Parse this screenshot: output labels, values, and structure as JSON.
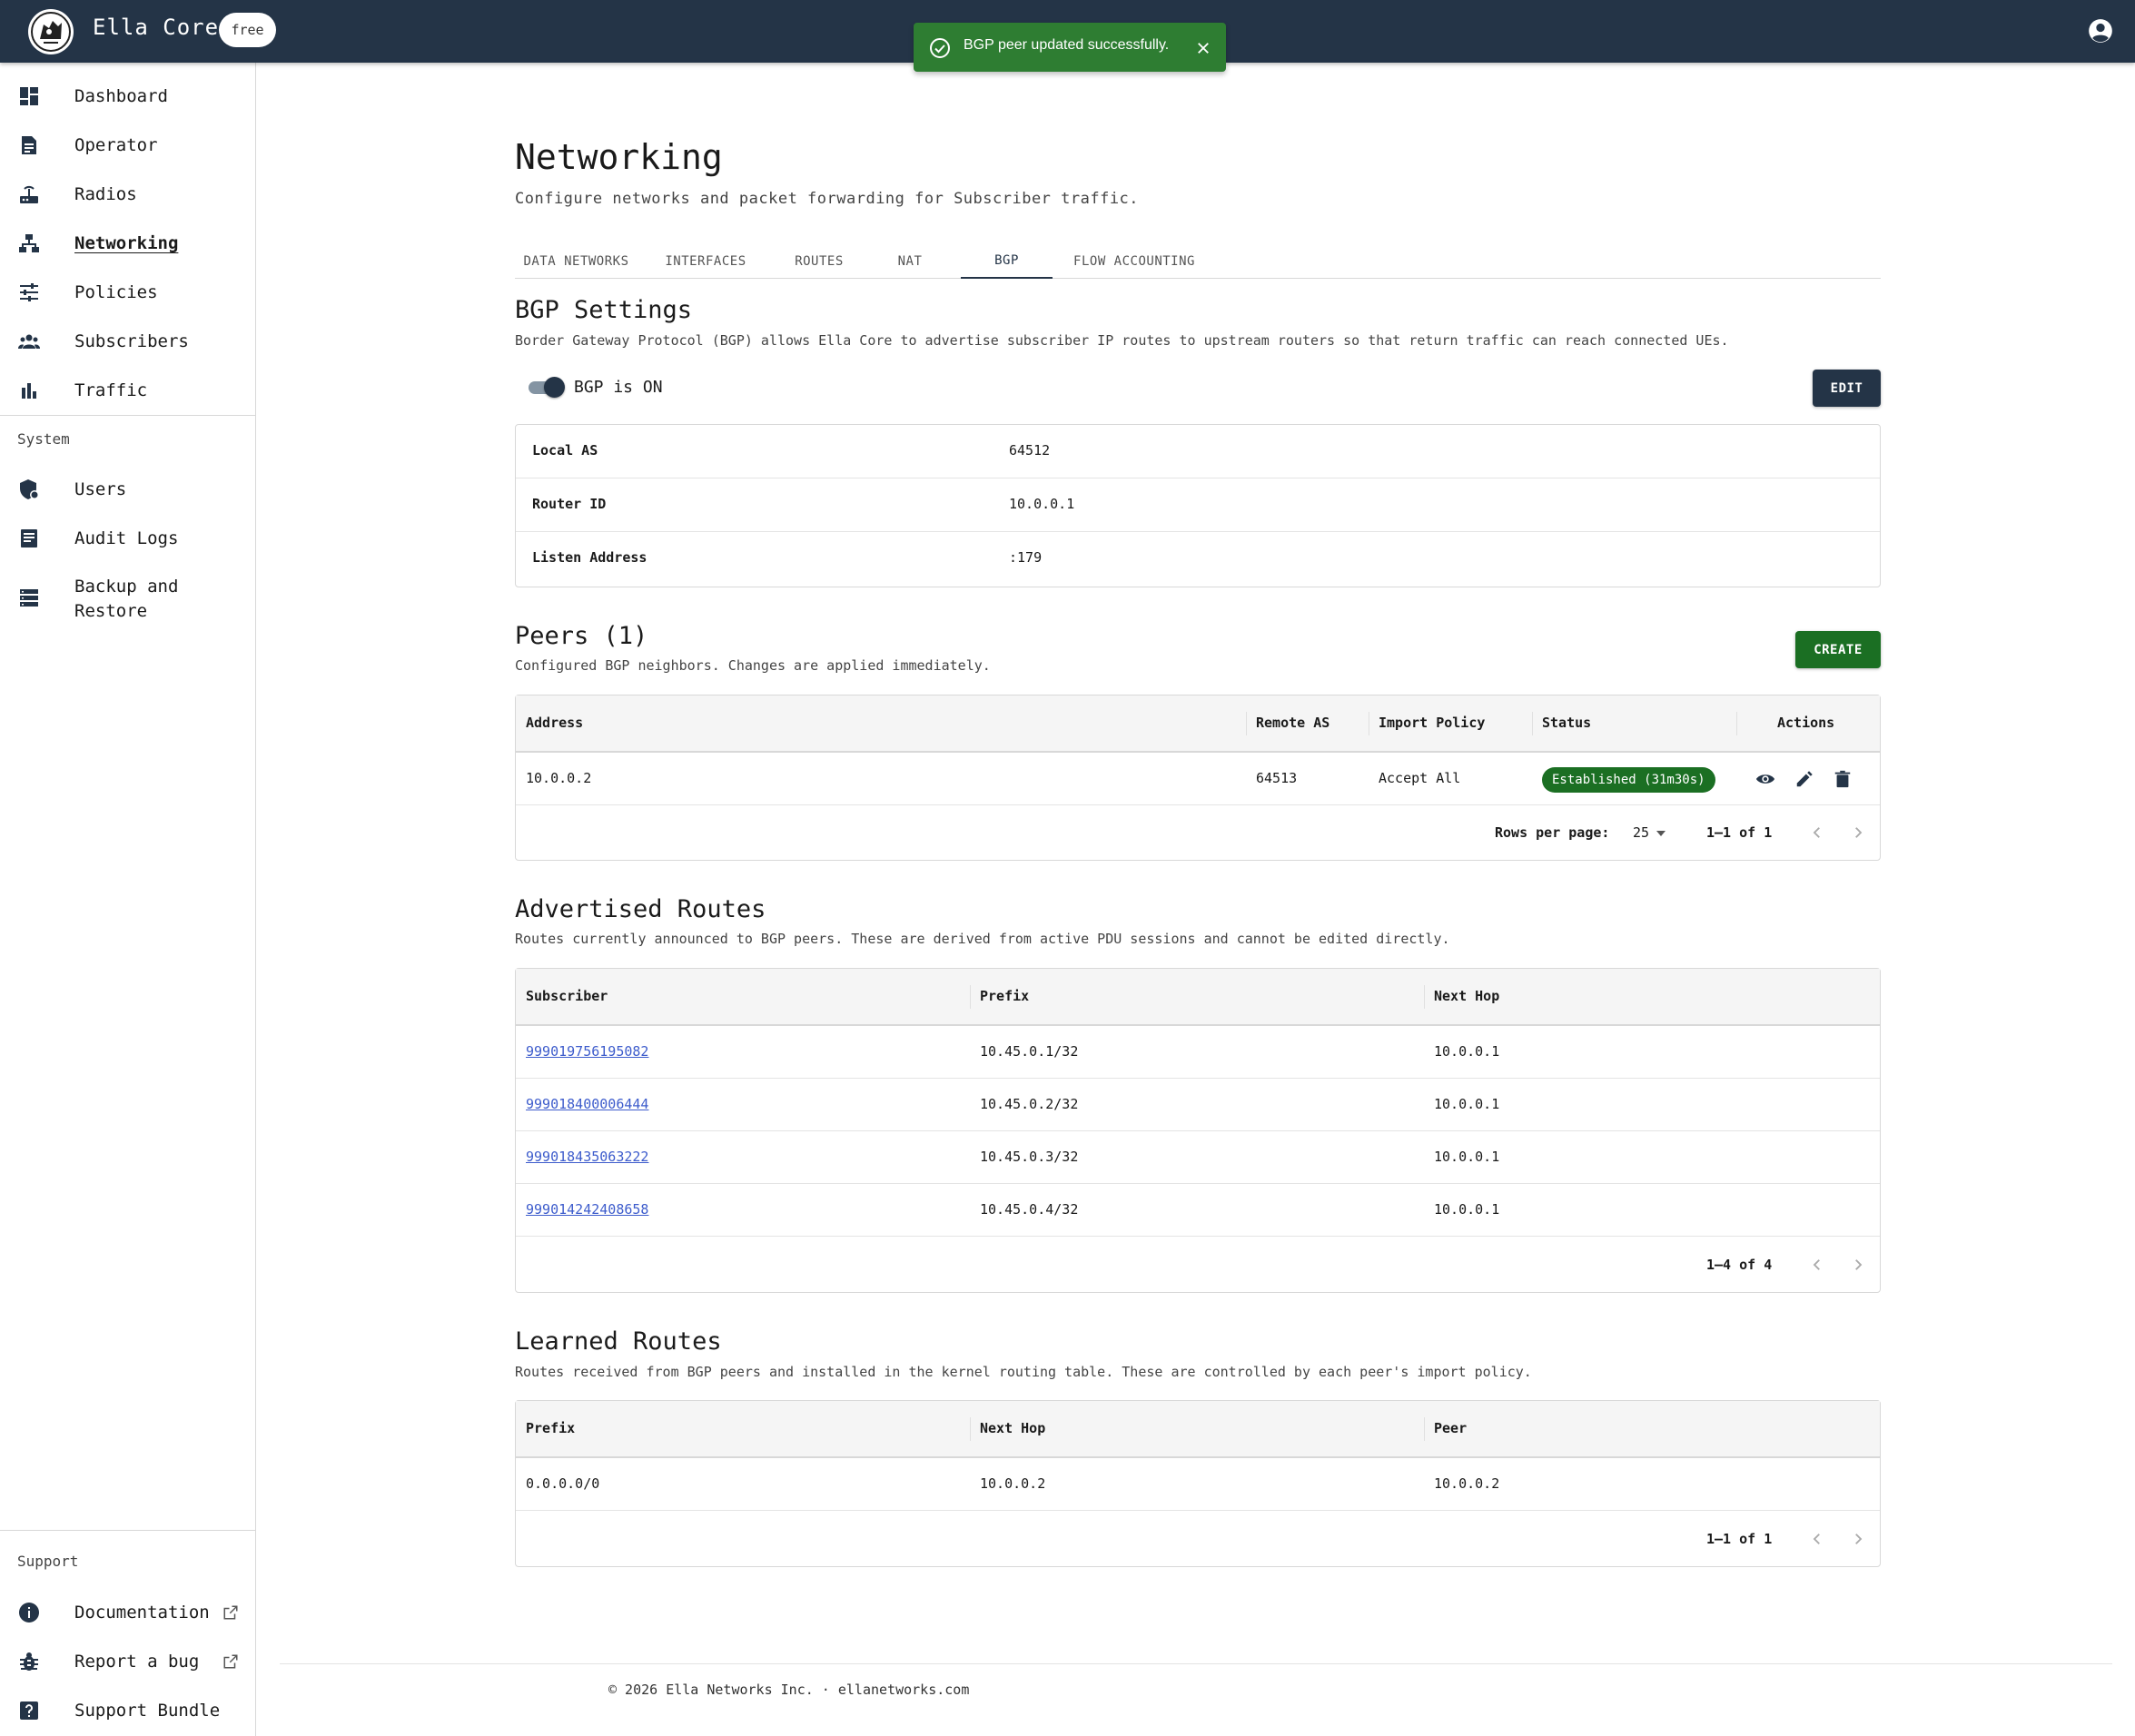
{
  "app": {
    "title": "Ella Core",
    "plan": "free"
  },
  "toast": {
    "message": "BGP peer updated successfully."
  },
  "sidebar": {
    "items": [
      {
        "label": "Dashboard",
        "icon": "dashboard-icon"
      },
      {
        "label": "Operator",
        "icon": "operator-icon"
      },
      {
        "label": "Radios",
        "icon": "router-icon"
      },
      {
        "label": "Networking",
        "icon": "network-icon"
      },
      {
        "label": "Policies",
        "icon": "sliders-icon"
      },
      {
        "label": "Subscribers",
        "icon": "group-icon"
      },
      {
        "label": "Traffic",
        "icon": "bar-chart-icon"
      }
    ],
    "system_label": "System",
    "system_items": [
      {
        "label": "Users",
        "icon": "admin-shield-icon"
      },
      {
        "label": "Audit Logs",
        "icon": "log-icon"
      },
      {
        "label": "Backup and Restore",
        "line1": "Backup and",
        "line2": "Restore",
        "icon": "storage-icon"
      }
    ],
    "support_label": "Support",
    "support_items": [
      {
        "label": "Documentation",
        "icon": "info-icon"
      },
      {
        "label": "Report a bug",
        "icon": "bug-icon"
      },
      {
        "label": "Support Bundle",
        "icon": "help-icon"
      }
    ]
  },
  "page": {
    "title": "Networking",
    "subtitle": "Configure networks and packet forwarding for Subscriber traffic.",
    "tabs": [
      "DATA NETWORKS",
      "INTERFACES",
      "ROUTES",
      "NAT",
      "BGP",
      "FLOW ACCOUNTING"
    ],
    "active_tab": "BGP"
  },
  "bgp_settings": {
    "title": "BGP Settings",
    "description": "Border Gateway Protocol (BGP) allows Ella Core to advertise subscriber IP routes to upstream routers so that return traffic can reach connected UEs.",
    "toggle_label": "BGP is ON",
    "toggle_on": true,
    "edit_label": "EDIT",
    "fields": [
      {
        "key": "Local AS",
        "value": "64512"
      },
      {
        "key": "Router ID",
        "value": "10.0.0.1"
      },
      {
        "key": "Listen Address",
        "value": ":179"
      }
    ]
  },
  "peers": {
    "title": "Peers (1)",
    "description": "Configured BGP neighbors. Changes are applied immediately.",
    "create_label": "CREATE",
    "columns": [
      "Address",
      "Remote AS",
      "Import Policy",
      "Status",
      "Actions"
    ],
    "rows": [
      {
        "address": "10.0.0.2",
        "remote_as": "64513",
        "import_policy": "Accept All",
        "status": "Established (31m30s)"
      }
    ],
    "rows_per_page_label": "Rows per page:",
    "rows_per_page": "25",
    "range": "1–1 of 1"
  },
  "advertised": {
    "title": "Advertised Routes",
    "description": "Routes currently announced to BGP peers. These are derived from active PDU sessions and cannot be edited directly.",
    "columns": [
      "Subscriber",
      "Prefix",
      "Next Hop"
    ],
    "rows": [
      {
        "subscriber": "999019756195082",
        "prefix": "10.45.0.1/32",
        "next_hop": "10.0.0.1"
      },
      {
        "subscriber": "999018400006444",
        "prefix": "10.45.0.2/32",
        "next_hop": "10.0.0.1"
      },
      {
        "subscriber": "999018435063222",
        "prefix": "10.45.0.3/32",
        "next_hop": "10.0.0.1"
      },
      {
        "subscriber": "999014242408658",
        "prefix": "10.45.0.4/32",
        "next_hop": "10.0.0.1"
      }
    ],
    "range": "1–4 of 4"
  },
  "learned": {
    "title": "Learned Routes",
    "description": "Routes received from BGP peers and installed in the kernel routing table. These are controlled by each peer's import policy.",
    "columns": [
      "Prefix",
      "Next Hop",
      "Peer"
    ],
    "rows": [
      {
        "prefix": "0.0.0.0/0",
        "next_hop": "10.0.0.2",
        "peer": "10.0.0.2"
      }
    ],
    "range": "1–1 of 1"
  },
  "footer": {
    "text": "© 2026 Ella Networks Inc. · ellanetworks.com"
  },
  "colors": {
    "header": "#243447",
    "success": "#2e7d32",
    "status_chip": "#1b6f23",
    "link": "#3d5ccc"
  }
}
